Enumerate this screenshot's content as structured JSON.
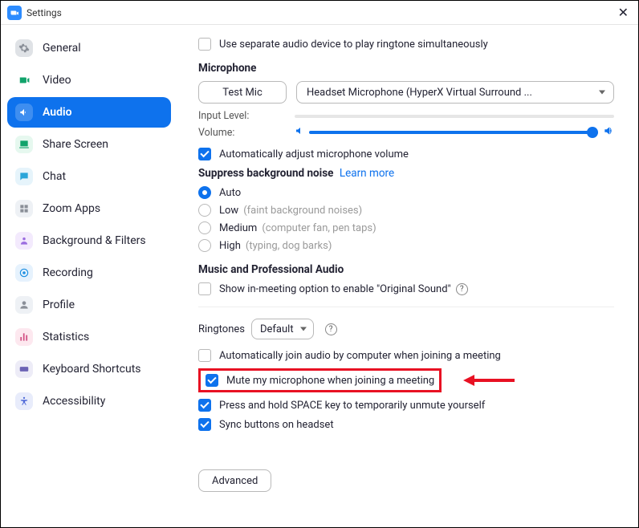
{
  "window": {
    "title": "Settings"
  },
  "sidebar": {
    "items": [
      {
        "label": "General",
        "icon": "gear",
        "bg": "#dfe2e6",
        "fg": "#8a8f98"
      },
      {
        "label": "Video",
        "icon": "video",
        "bg": "#ffffff",
        "fg": "#11a36b"
      },
      {
        "label": "Audio",
        "icon": "audio",
        "bg": "#ffffff",
        "fg": "#ffffff",
        "active": true
      },
      {
        "label": "Share Screen",
        "icon": "share",
        "bg": "#e6f8ef",
        "fg": "#11a36b"
      },
      {
        "label": "Chat",
        "icon": "chat",
        "bg": "#e6f4fb",
        "fg": "#2aa5d9"
      },
      {
        "label": "Zoom Apps",
        "icon": "apps",
        "bg": "#eef1f5",
        "fg": "#8a8f98"
      },
      {
        "label": "Background & Filters",
        "icon": "bg",
        "bg": "#f3eafd",
        "fg": "#9b6de0"
      },
      {
        "label": "Recording",
        "icon": "rec",
        "bg": "#e6f2fd",
        "fg": "#1d8fe1"
      },
      {
        "label": "Profile",
        "icon": "profile",
        "bg": "#eef1f5",
        "fg": "#8a8f98"
      },
      {
        "label": "Statistics",
        "icon": "stats",
        "bg": "#fde8ef",
        "fg": "#d15084"
      },
      {
        "label": "Keyboard Shortcuts",
        "icon": "kbd",
        "bg": "#edecf7",
        "fg": "#6c63b5"
      },
      {
        "label": "Accessibility",
        "icon": "a11y",
        "bg": "#e8ecfb",
        "fg": "#4f69d8"
      }
    ]
  },
  "audio": {
    "separate_device_label": "Use separate audio device to play ringtone simultaneously",
    "mic_title": "Microphone",
    "test_mic_label": "Test Mic",
    "mic_device": "Headset Microphone (HyperX Virtual Surround ...",
    "input_level_label": "Input Level:",
    "volume_label": "Volume:",
    "volume_percent": 98,
    "auto_adjust_label": "Automatically adjust microphone volume",
    "suppress_title": "Suppress background noise",
    "learn_more": "Learn more",
    "noise_levels": [
      {
        "label": "Auto",
        "hint": ""
      },
      {
        "label": "Low",
        "hint": "(faint background noises)"
      },
      {
        "label": "Medium",
        "hint": "(computer fan, pen taps)"
      },
      {
        "label": "High",
        "hint": "(typing, dog barks)"
      }
    ],
    "music_title": "Music and Professional Audio",
    "original_sound_label": "Show in-meeting option to enable \"Original Sound\"",
    "ringtones_label": "Ringtones",
    "ringtone_value": "Default",
    "auto_join_label": "Automatically join audio by computer when joining a meeting",
    "mute_on_join_label": "Mute my microphone when joining a meeting",
    "space_unmute_label": "Press and hold SPACE key to temporarily unmute yourself",
    "sync_headset_label": "Sync buttons on headset",
    "advanced_label": "Advanced"
  }
}
